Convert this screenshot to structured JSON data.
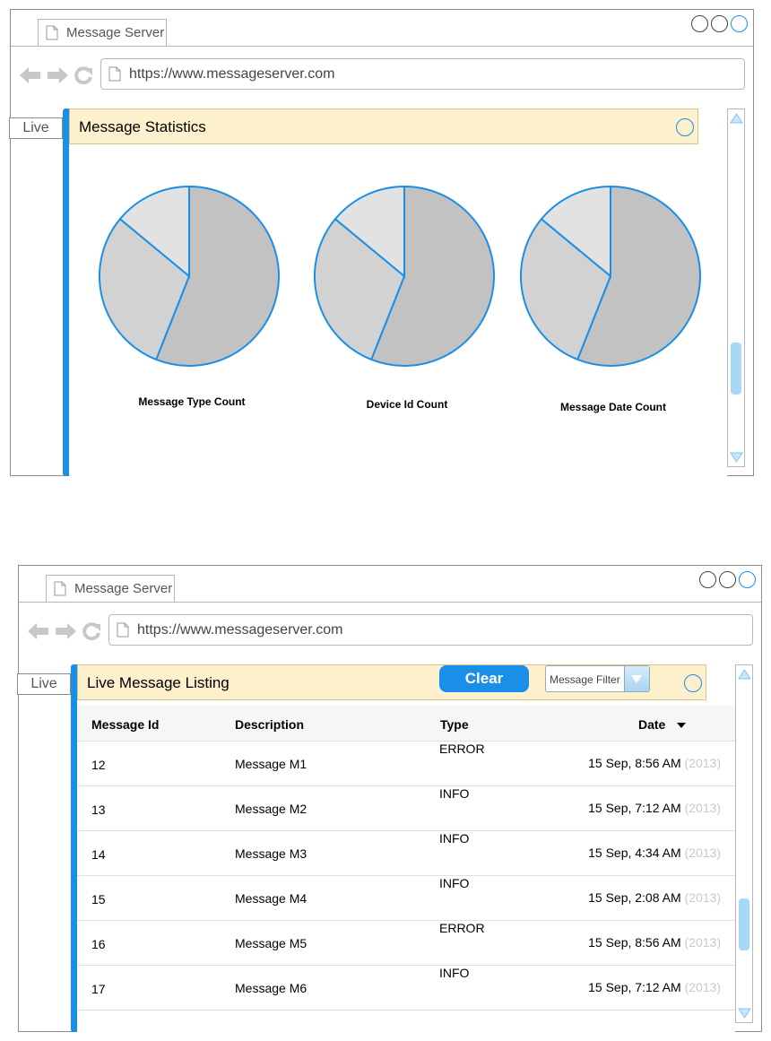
{
  "windows": [
    {
      "tab_title": "Message Server",
      "url": "https://www.messageserver.com",
      "side_tab": "Live",
      "panel_title": "Message Statistics"
    },
    {
      "tab_title": "Message Server",
      "url": "https://www.messageserver.com",
      "side_tab": "Live",
      "panel_title": "Live Message Listing",
      "clear_label": "Clear",
      "filter_label": "Message Filter"
    }
  ],
  "icons": {
    "back": "arrow-left-icon",
    "forward": "arrow-right-icon",
    "reload": "reload-icon",
    "page": "page-icon",
    "sort": "caret-down-icon",
    "dropdown": "triangle-down-icon"
  },
  "colors": {
    "accent": "#1a8fe8",
    "panel_header_bg": "#fdf0cc",
    "pie_slice_1": "#c2c2c2",
    "pie_slice_2": "#d2d2d2",
    "pie_slice_3": "#e2e2e2",
    "year_text": "#c9c9c9",
    "scroll_thumb": "#a8d8f8"
  },
  "chart_data": [
    {
      "type": "pie",
      "caption": "Message Type Count",
      "values": [
        56,
        30,
        14
      ]
    },
    {
      "type": "pie",
      "caption": "Device Id Count",
      "values": [
        56,
        30,
        14
      ]
    },
    {
      "type": "pie",
      "caption": "Message Date Count",
      "values": [
        56,
        30,
        14
      ]
    }
  ],
  "table": {
    "columns": [
      "Message Id",
      "Description",
      "Type",
      "Date"
    ],
    "rows": [
      {
        "id": "12",
        "description": "Message M1",
        "type": "ERROR",
        "date": "15 Sep, 8:56 AM",
        "year": "(2013)"
      },
      {
        "id": "13",
        "description": "Message M2",
        "type": "INFO",
        "date": "15 Sep, 7:12 AM",
        "year": "(2013)"
      },
      {
        "id": "14",
        "description": "Message M3",
        "type": "INFO",
        "date": "15 Sep, 4:34 AM",
        "year": "(2013)"
      },
      {
        "id": "15",
        "description": "Message M4",
        "type": "INFO",
        "date": "15 Sep, 2:08 AM",
        "year": "(2013)"
      },
      {
        "id": "16",
        "description": "Message M5",
        "type": "ERROR",
        "date": "15 Sep, 8:56 AM",
        "year": "(2013)"
      },
      {
        "id": "17",
        "description": "Message M6",
        "type": "INFO",
        "date": "15 Sep, 7:12 AM",
        "year": "(2013)"
      }
    ]
  }
}
